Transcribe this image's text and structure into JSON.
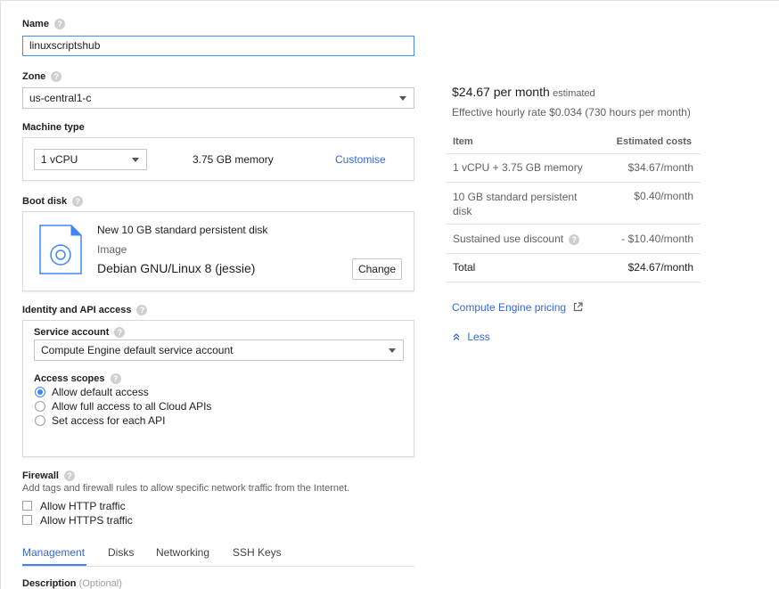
{
  "name": {
    "label": "Name",
    "value": "linuxscriptshub"
  },
  "zone": {
    "label": "Zone",
    "value": "us-central1-c"
  },
  "machine_type": {
    "label": "Machine type",
    "cpu_value": "1 vCPU",
    "memory": "3.75 GB memory",
    "customise_label": "Customise"
  },
  "boot_disk": {
    "label": "Boot disk",
    "title": "New 10 GB standard persistent disk",
    "image_label": "Image",
    "image_name": "Debian GNU/Linux 8 (jessie)",
    "change_label": "Change"
  },
  "identity": {
    "label": "Identity and API access",
    "service_account_label": "Service account",
    "service_account_value": "Compute Engine default service account",
    "access_scopes_label": "Access scopes",
    "scopes": [
      {
        "label": "Allow default access",
        "selected": true
      },
      {
        "label": "Allow full access to all Cloud APIs",
        "selected": false
      },
      {
        "label": "Set access for each API",
        "selected": false
      }
    ]
  },
  "firewall": {
    "label": "Firewall",
    "description": "Add tags and firewall rules to allow specific network traffic from the Internet.",
    "http_label": "Allow HTTP traffic",
    "https_label": "Allow HTTPS traffic"
  },
  "tabs": [
    {
      "label": "Management",
      "active": true
    },
    {
      "label": "Disks",
      "active": false
    },
    {
      "label": "Networking",
      "active": false
    },
    {
      "label": "SSH Keys",
      "active": false
    }
  ],
  "description": {
    "label": "Description",
    "optional": "(Optional)"
  },
  "pricing": {
    "monthly": "$24.67 per month",
    "estimated": "estimated",
    "hourly": "Effective hourly rate $0.034 (730 hours per month)",
    "col_item": "Item",
    "col_cost": "Estimated costs",
    "rows": [
      {
        "item": "1 vCPU + 3.75 GB memory",
        "cost": "$34.67/month"
      },
      {
        "item": "10 GB standard persistent disk",
        "cost": "$0.40/month"
      },
      {
        "item": "Sustained use discount",
        "cost": "- $10.40/month"
      }
    ],
    "total_label": "Total",
    "total_cost": "$24.67/month",
    "pricing_link": "Compute Engine pricing",
    "less_label": "Less"
  },
  "colors": {
    "accent": "#3367d6",
    "focus_border": "#4a8af4",
    "radio": "#4285f4"
  }
}
